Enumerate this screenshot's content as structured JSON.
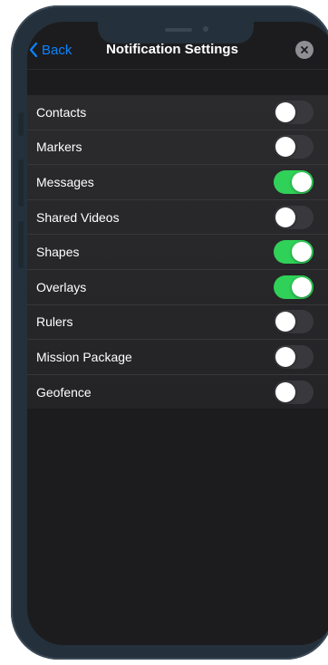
{
  "nav": {
    "back_label": "Back",
    "title": "Notification Settings",
    "close_icon": "close-icon"
  },
  "settings": {
    "items": [
      {
        "label": "Contacts",
        "enabled": false
      },
      {
        "label": "Markers",
        "enabled": false
      },
      {
        "label": "Messages",
        "enabled": true
      },
      {
        "label": "Shared Videos",
        "enabled": false
      },
      {
        "label": "Shapes",
        "enabled": true
      },
      {
        "label": "Overlays",
        "enabled": true
      },
      {
        "label": "Rulers",
        "enabled": false
      },
      {
        "label": "Mission Package",
        "enabled": false
      },
      {
        "label": "Geofence",
        "enabled": false
      }
    ]
  },
  "colors": {
    "accent": "#0a84ff",
    "toggle_on": "#30d158",
    "toggle_off": "#39393d",
    "background": "#1c1c1e"
  }
}
